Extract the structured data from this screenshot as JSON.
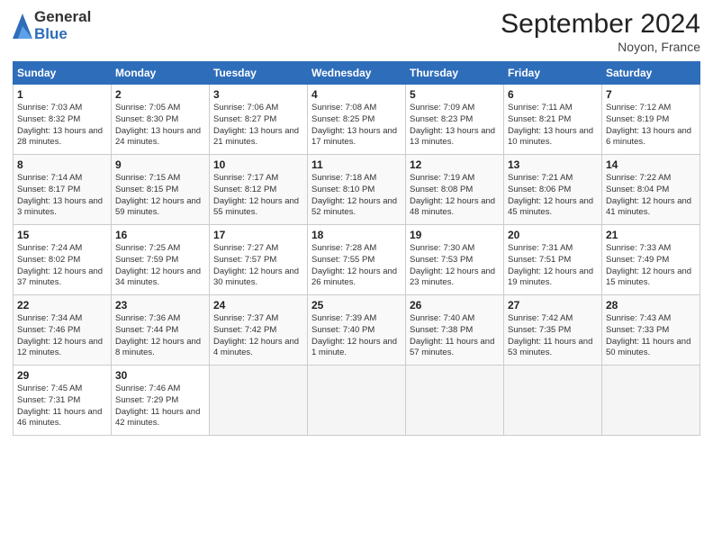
{
  "logo": {
    "general": "General",
    "blue": "Blue"
  },
  "title": "September 2024",
  "location": "Noyon, France",
  "days_header": [
    "Sunday",
    "Monday",
    "Tuesday",
    "Wednesday",
    "Thursday",
    "Friday",
    "Saturday"
  ],
  "weeks": [
    [
      {
        "num": "1",
        "sunrise": "7:03 AM",
        "sunset": "8:32 PM",
        "daylight": "13 hours and 28 minutes."
      },
      {
        "num": "2",
        "sunrise": "7:05 AM",
        "sunset": "8:30 PM",
        "daylight": "13 hours and 24 minutes."
      },
      {
        "num": "3",
        "sunrise": "7:06 AM",
        "sunset": "8:27 PM",
        "daylight": "13 hours and 21 minutes."
      },
      {
        "num": "4",
        "sunrise": "7:08 AM",
        "sunset": "8:25 PM",
        "daylight": "13 hours and 17 minutes."
      },
      {
        "num": "5",
        "sunrise": "7:09 AM",
        "sunset": "8:23 PM",
        "daylight": "13 hours and 13 minutes."
      },
      {
        "num": "6",
        "sunrise": "7:11 AM",
        "sunset": "8:21 PM",
        "daylight": "13 hours and 10 minutes."
      },
      {
        "num": "7",
        "sunrise": "7:12 AM",
        "sunset": "8:19 PM",
        "daylight": "13 hours and 6 minutes."
      }
    ],
    [
      {
        "num": "8",
        "sunrise": "7:14 AM",
        "sunset": "8:17 PM",
        "daylight": "13 hours and 3 minutes."
      },
      {
        "num": "9",
        "sunrise": "7:15 AM",
        "sunset": "8:15 PM",
        "daylight": "12 hours and 59 minutes."
      },
      {
        "num": "10",
        "sunrise": "7:17 AM",
        "sunset": "8:12 PM",
        "daylight": "12 hours and 55 minutes."
      },
      {
        "num": "11",
        "sunrise": "7:18 AM",
        "sunset": "8:10 PM",
        "daylight": "12 hours and 52 minutes."
      },
      {
        "num": "12",
        "sunrise": "7:19 AM",
        "sunset": "8:08 PM",
        "daylight": "12 hours and 48 minutes."
      },
      {
        "num": "13",
        "sunrise": "7:21 AM",
        "sunset": "8:06 PM",
        "daylight": "12 hours and 45 minutes."
      },
      {
        "num": "14",
        "sunrise": "7:22 AM",
        "sunset": "8:04 PM",
        "daylight": "12 hours and 41 minutes."
      }
    ],
    [
      {
        "num": "15",
        "sunrise": "7:24 AM",
        "sunset": "8:02 PM",
        "daylight": "12 hours and 37 minutes."
      },
      {
        "num": "16",
        "sunrise": "7:25 AM",
        "sunset": "7:59 PM",
        "daylight": "12 hours and 34 minutes."
      },
      {
        "num": "17",
        "sunrise": "7:27 AM",
        "sunset": "7:57 PM",
        "daylight": "12 hours and 30 minutes."
      },
      {
        "num": "18",
        "sunrise": "7:28 AM",
        "sunset": "7:55 PM",
        "daylight": "12 hours and 26 minutes."
      },
      {
        "num": "19",
        "sunrise": "7:30 AM",
        "sunset": "7:53 PM",
        "daylight": "12 hours and 23 minutes."
      },
      {
        "num": "20",
        "sunrise": "7:31 AM",
        "sunset": "7:51 PM",
        "daylight": "12 hours and 19 minutes."
      },
      {
        "num": "21",
        "sunrise": "7:33 AM",
        "sunset": "7:49 PM",
        "daylight": "12 hours and 15 minutes."
      }
    ],
    [
      {
        "num": "22",
        "sunrise": "7:34 AM",
        "sunset": "7:46 PM",
        "daylight": "12 hours and 12 minutes."
      },
      {
        "num": "23",
        "sunrise": "7:36 AM",
        "sunset": "7:44 PM",
        "daylight": "12 hours and 8 minutes."
      },
      {
        "num": "24",
        "sunrise": "7:37 AM",
        "sunset": "7:42 PM",
        "daylight": "12 hours and 4 minutes."
      },
      {
        "num": "25",
        "sunrise": "7:39 AM",
        "sunset": "7:40 PM",
        "daylight": "12 hours and 1 minute."
      },
      {
        "num": "26",
        "sunrise": "7:40 AM",
        "sunset": "7:38 PM",
        "daylight": "11 hours and 57 minutes."
      },
      {
        "num": "27",
        "sunrise": "7:42 AM",
        "sunset": "7:35 PM",
        "daylight": "11 hours and 53 minutes."
      },
      {
        "num": "28",
        "sunrise": "7:43 AM",
        "sunset": "7:33 PM",
        "daylight": "11 hours and 50 minutes."
      }
    ],
    [
      {
        "num": "29",
        "sunrise": "7:45 AM",
        "sunset": "7:31 PM",
        "daylight": "11 hours and 46 minutes."
      },
      {
        "num": "30",
        "sunrise": "7:46 AM",
        "sunset": "7:29 PM",
        "daylight": "11 hours and 42 minutes."
      },
      null,
      null,
      null,
      null,
      null
    ]
  ],
  "labels": {
    "sunrise": "Sunrise:",
    "sunset": "Sunset:",
    "daylight": "Daylight:"
  }
}
